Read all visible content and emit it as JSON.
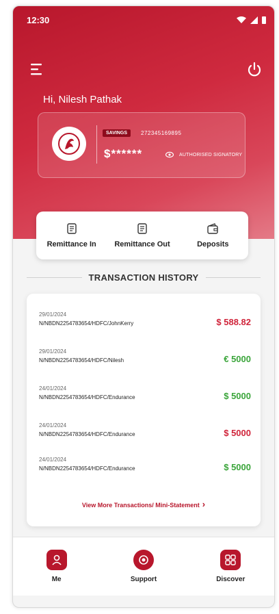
{
  "status_bar": {
    "time": "12:30"
  },
  "header": {
    "greeting": "Hi, Nilesh Pathak"
  },
  "account": {
    "type": "SAVINGS",
    "number": "272345169895",
    "balance": "$******",
    "role": "AUTHORISED SIGNATORY"
  },
  "quick_actions": [
    {
      "label": "Remittance In",
      "icon": "remittance-in-icon"
    },
    {
      "label": "Remittance Out",
      "icon": "remittance-out-icon"
    },
    {
      "label": "Deposits",
      "icon": "wallet-icon"
    }
  ],
  "history": {
    "title": "TRANSACTION HISTORY",
    "view_more": "View More Transactions/ Mini-Statement",
    "transactions": [
      {
        "date": "29/01/2024",
        "ref": "N/NBDN2254783654/HDFC/JohnKerry",
        "amount": "$ 588.82",
        "color": "#d0243a"
      },
      {
        "date": "29/01/2024",
        "ref": "N/NBDN2254783654/HDFC/Nilesh",
        "amount": "€ 5000",
        "color": "#3aa53a"
      },
      {
        "date": "24/01/2024",
        "ref": "N/NBDN2254783654/HDFC/Endurance",
        "amount": "$ 5000",
        "color": "#3aa53a"
      },
      {
        "date": "24/01/2024",
        "ref": "N/NBDN2254783654/HDFC/Endurance",
        "amount": "$ 5000",
        "color": "#d0243a"
      },
      {
        "date": "24/01/2024",
        "ref": "N/NBDN2254783654/HDFC/Endurance",
        "amount": "$ 5000",
        "color": "#3aa53a"
      }
    ]
  },
  "bottom_nav": [
    {
      "label": "Me",
      "icon": "person-icon"
    },
    {
      "label": "Support",
      "icon": "support-icon"
    },
    {
      "label": "Discover",
      "icon": "grid-icon"
    }
  ],
  "colors": {
    "brand": "#b8172c",
    "credit": "#3aa53a",
    "debit": "#d0243a"
  }
}
